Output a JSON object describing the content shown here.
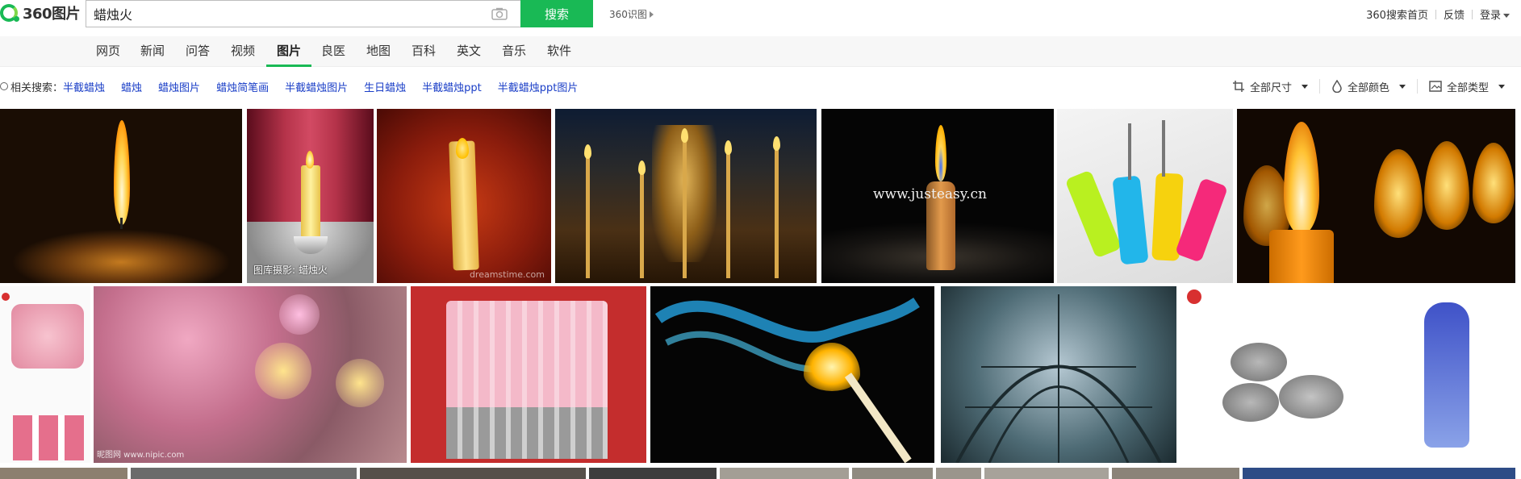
{
  "header": {
    "logo_text": "360图片",
    "search_value": "蜡烛火",
    "search_button": "搜索",
    "shitu_label": "360识图",
    "links": [
      "360搜索首页",
      "反馈",
      "登录"
    ]
  },
  "nav": {
    "tabs": [
      "网页",
      "新闻",
      "问答",
      "视频",
      "图片",
      "良医",
      "地图",
      "百科",
      "英文",
      "音乐",
      "软件"
    ],
    "active": "图片"
  },
  "related": {
    "label": "相关搜索：",
    "items": [
      "半截蜡烛",
      "蜡烛",
      "蜡烛图片",
      "蜡烛简笔画",
      "半截蜡烛图片",
      "生日蜡烛",
      "半截蜡烛ppt",
      "半截蜡烛ppt图片"
    ]
  },
  "filters": {
    "size": "全部尺寸",
    "color": "全部颜色",
    "type": "全部类型"
  },
  "images": {
    "caption_2": "图库摄影: 蜡烛火",
    "watermark_3": "dreamstime.com",
    "watermark_5": "www.justeasy.cn",
    "watermark_row2_1": "昵图网 www.nipic.com"
  },
  "colors": {
    "brand_green": "#19b955",
    "link_blue": "#1a3ec7"
  }
}
